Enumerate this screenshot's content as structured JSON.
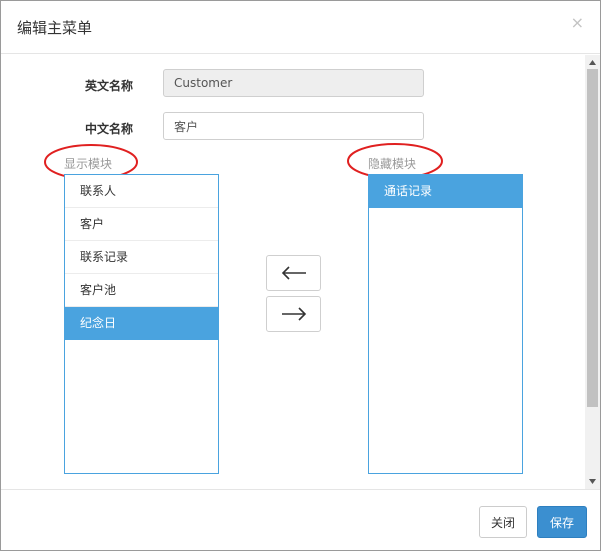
{
  "dialog": {
    "title": "编辑主菜单",
    "close_glyph": "×"
  },
  "form": {
    "english_name_label": "英文名称",
    "english_name_value": "Customer",
    "chinese_name_label": "中文名称",
    "chinese_name_value": "客户"
  },
  "visible_modules": {
    "label": "显示模块",
    "items": [
      "联系人",
      "客户",
      "联系记录",
      "客户池",
      "纪念日"
    ],
    "selected_index": 4
  },
  "hidden_modules": {
    "label": "隐藏模块",
    "items": [
      "通话记录"
    ],
    "selected_index": 0
  },
  "move_buttons": {
    "left_icon": "arrow-left-icon",
    "right_icon": "arrow-right-icon"
  },
  "footer": {
    "close_label": "关闭",
    "save_label": "保存"
  },
  "colors": {
    "selected": "#4aa3df",
    "primary_button": "#3b8fd0",
    "annotation_ellipse": "#e02020"
  }
}
